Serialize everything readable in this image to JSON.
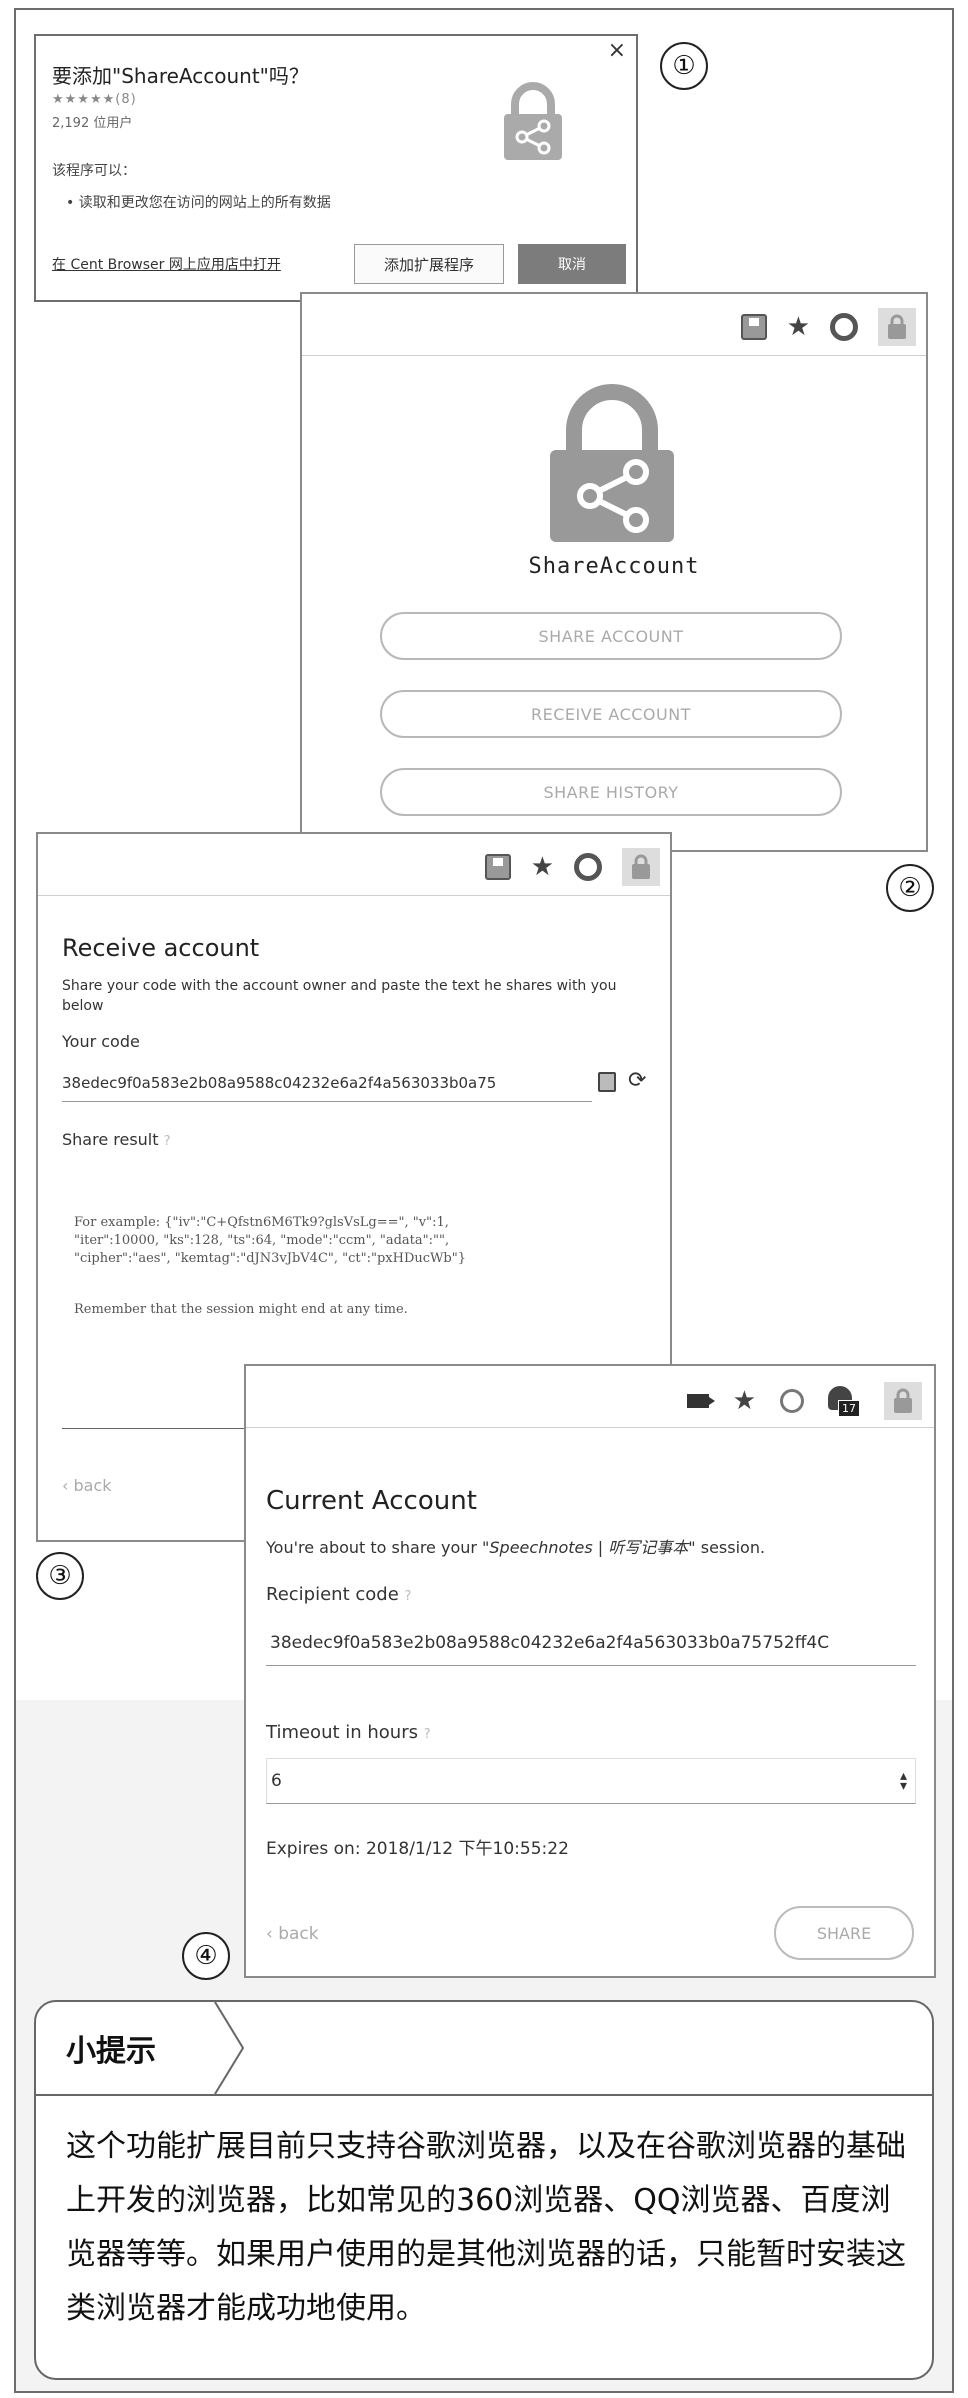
{
  "panel1": {
    "title": "要添加\"ShareAccount\"吗？",
    "stars": "★★★★★(8)",
    "users": "2,192 位用户",
    "can_label": "该程序可以：",
    "permission": "读取和更改您在访问的网站上的所有数据",
    "link": "在 Cent Browser 网上应用店中打开",
    "add_button": "添加扩展程序",
    "cancel_button": "取消",
    "close": "×",
    "badge": "①"
  },
  "panel2": {
    "app_name": "ShareAccount",
    "buttons": [
      "SHARE ACCOUNT",
      "RECEIVE ACCOUNT",
      "SHARE HISTORY"
    ],
    "badge": "②",
    "icons": [
      "save-icon",
      "star-icon",
      "ring-icon",
      "shareaccount-lock-icon"
    ]
  },
  "panel3": {
    "heading": "Receive account",
    "description": "Share your code with the account owner and paste the text he shares with you below",
    "your_code_label": "Your code",
    "code_value": "38edec9f0a583e2b08a9588c04232e6a2f4a563033b0a75",
    "share_result_label": "Share result",
    "example": "For example: {\"iv\":\"C+Qfstn6M6Tk9?glsVsLg==\", \"v\":1,\n\"iter\":10000, \"ks\":128, \"ts\":64, \"mode\":\"ccm\", \"adata\":\"\",\n\"cipher\":\"aes\", \"kemtag\":\"dJN3vJbV4C\", \"ct\":\"pxHDucWb\"}",
    "remember": "Remember that the session might end at any time.",
    "back": "‹ back",
    "badge": "③"
  },
  "panel4": {
    "heading": "Current Account",
    "sub_prefix": "You're about to share your ",
    "sub_session": "\"Speechnotes | 听写记事本\"",
    "sub_suffix": " session.",
    "recipient_label": "Recipient code",
    "recipient_value": "38edec9f0a583e2b08a9588c04232e6a2f4a563033b0a75752ff4C",
    "timeout_label": "Timeout in hours",
    "timeout_value": "6",
    "expires": "Expires on: 2018/1/12 下午10:55:22",
    "back": "‹ back",
    "share_button": "SHARE",
    "extension_count": "17",
    "badge": "④"
  },
  "tip": {
    "title": "小提示",
    "body": "这个功能扩展目前只支持谷歌浏览器，以及在谷歌浏览器的基础上开发的浏览器，比如常见的360浏览器、QQ浏览器、百度浏览器等等。如果用户使用的是其他浏览器的话，只能暂时安装这类浏览器才能成功地使用。"
  }
}
